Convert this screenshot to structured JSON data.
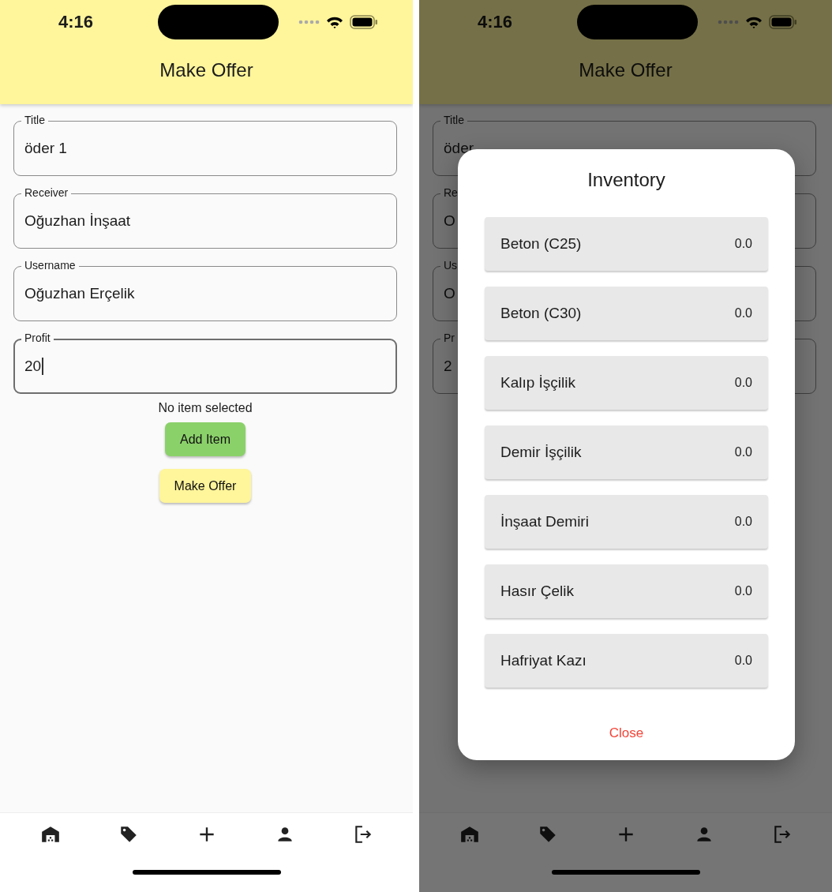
{
  "screens": [
    {
      "status_bar": {
        "time": "4:16"
      },
      "app_bar": {
        "title": "Make Offer"
      },
      "fields": [
        {
          "label": "Title",
          "value": "öder 1",
          "focused": false
        },
        {
          "label": "Receiver",
          "value": "Oğuzhan İnşaat",
          "focused": false
        },
        {
          "label": "Username",
          "value": "Oğuzhan Erçelik",
          "focused": false
        },
        {
          "label": "Profit",
          "value": "20",
          "focused": true
        }
      ],
      "status_text": "No item selected",
      "buttons": [
        {
          "label": "Add Item",
          "kind": "add"
        },
        {
          "label": "Make Offer",
          "kind": "submit"
        }
      ]
    },
    {
      "status_bar": {
        "time": "4:16"
      },
      "app_bar": {
        "title": "Make Offer"
      },
      "fields": [
        {
          "label": "Title",
          "value": "öder",
          "focused": false
        },
        {
          "label": "Re",
          "value": "O",
          "focused": false
        },
        {
          "label": "Us",
          "value": "O",
          "focused": false
        },
        {
          "label": "Pr",
          "value": "2",
          "focused": false
        }
      ],
      "dialog": {
        "title": "Inventory",
        "items": [
          {
            "name": "Beton (C25)",
            "value": "0.0"
          },
          {
            "name": "Beton (C30)",
            "value": "0.0"
          },
          {
            "name": "Kalıp İşçilik",
            "value": "0.0"
          },
          {
            "name": "Demir İşçilik",
            "value": "0.0"
          },
          {
            "name": "İnşaat Demiri",
            "value": "0.0"
          },
          {
            "name": "Hasır Çelik",
            "value": "0.0"
          },
          {
            "name": "Hafriyat Kazı",
            "value": "0.0"
          }
        ],
        "close": "Close"
      }
    }
  ]
}
